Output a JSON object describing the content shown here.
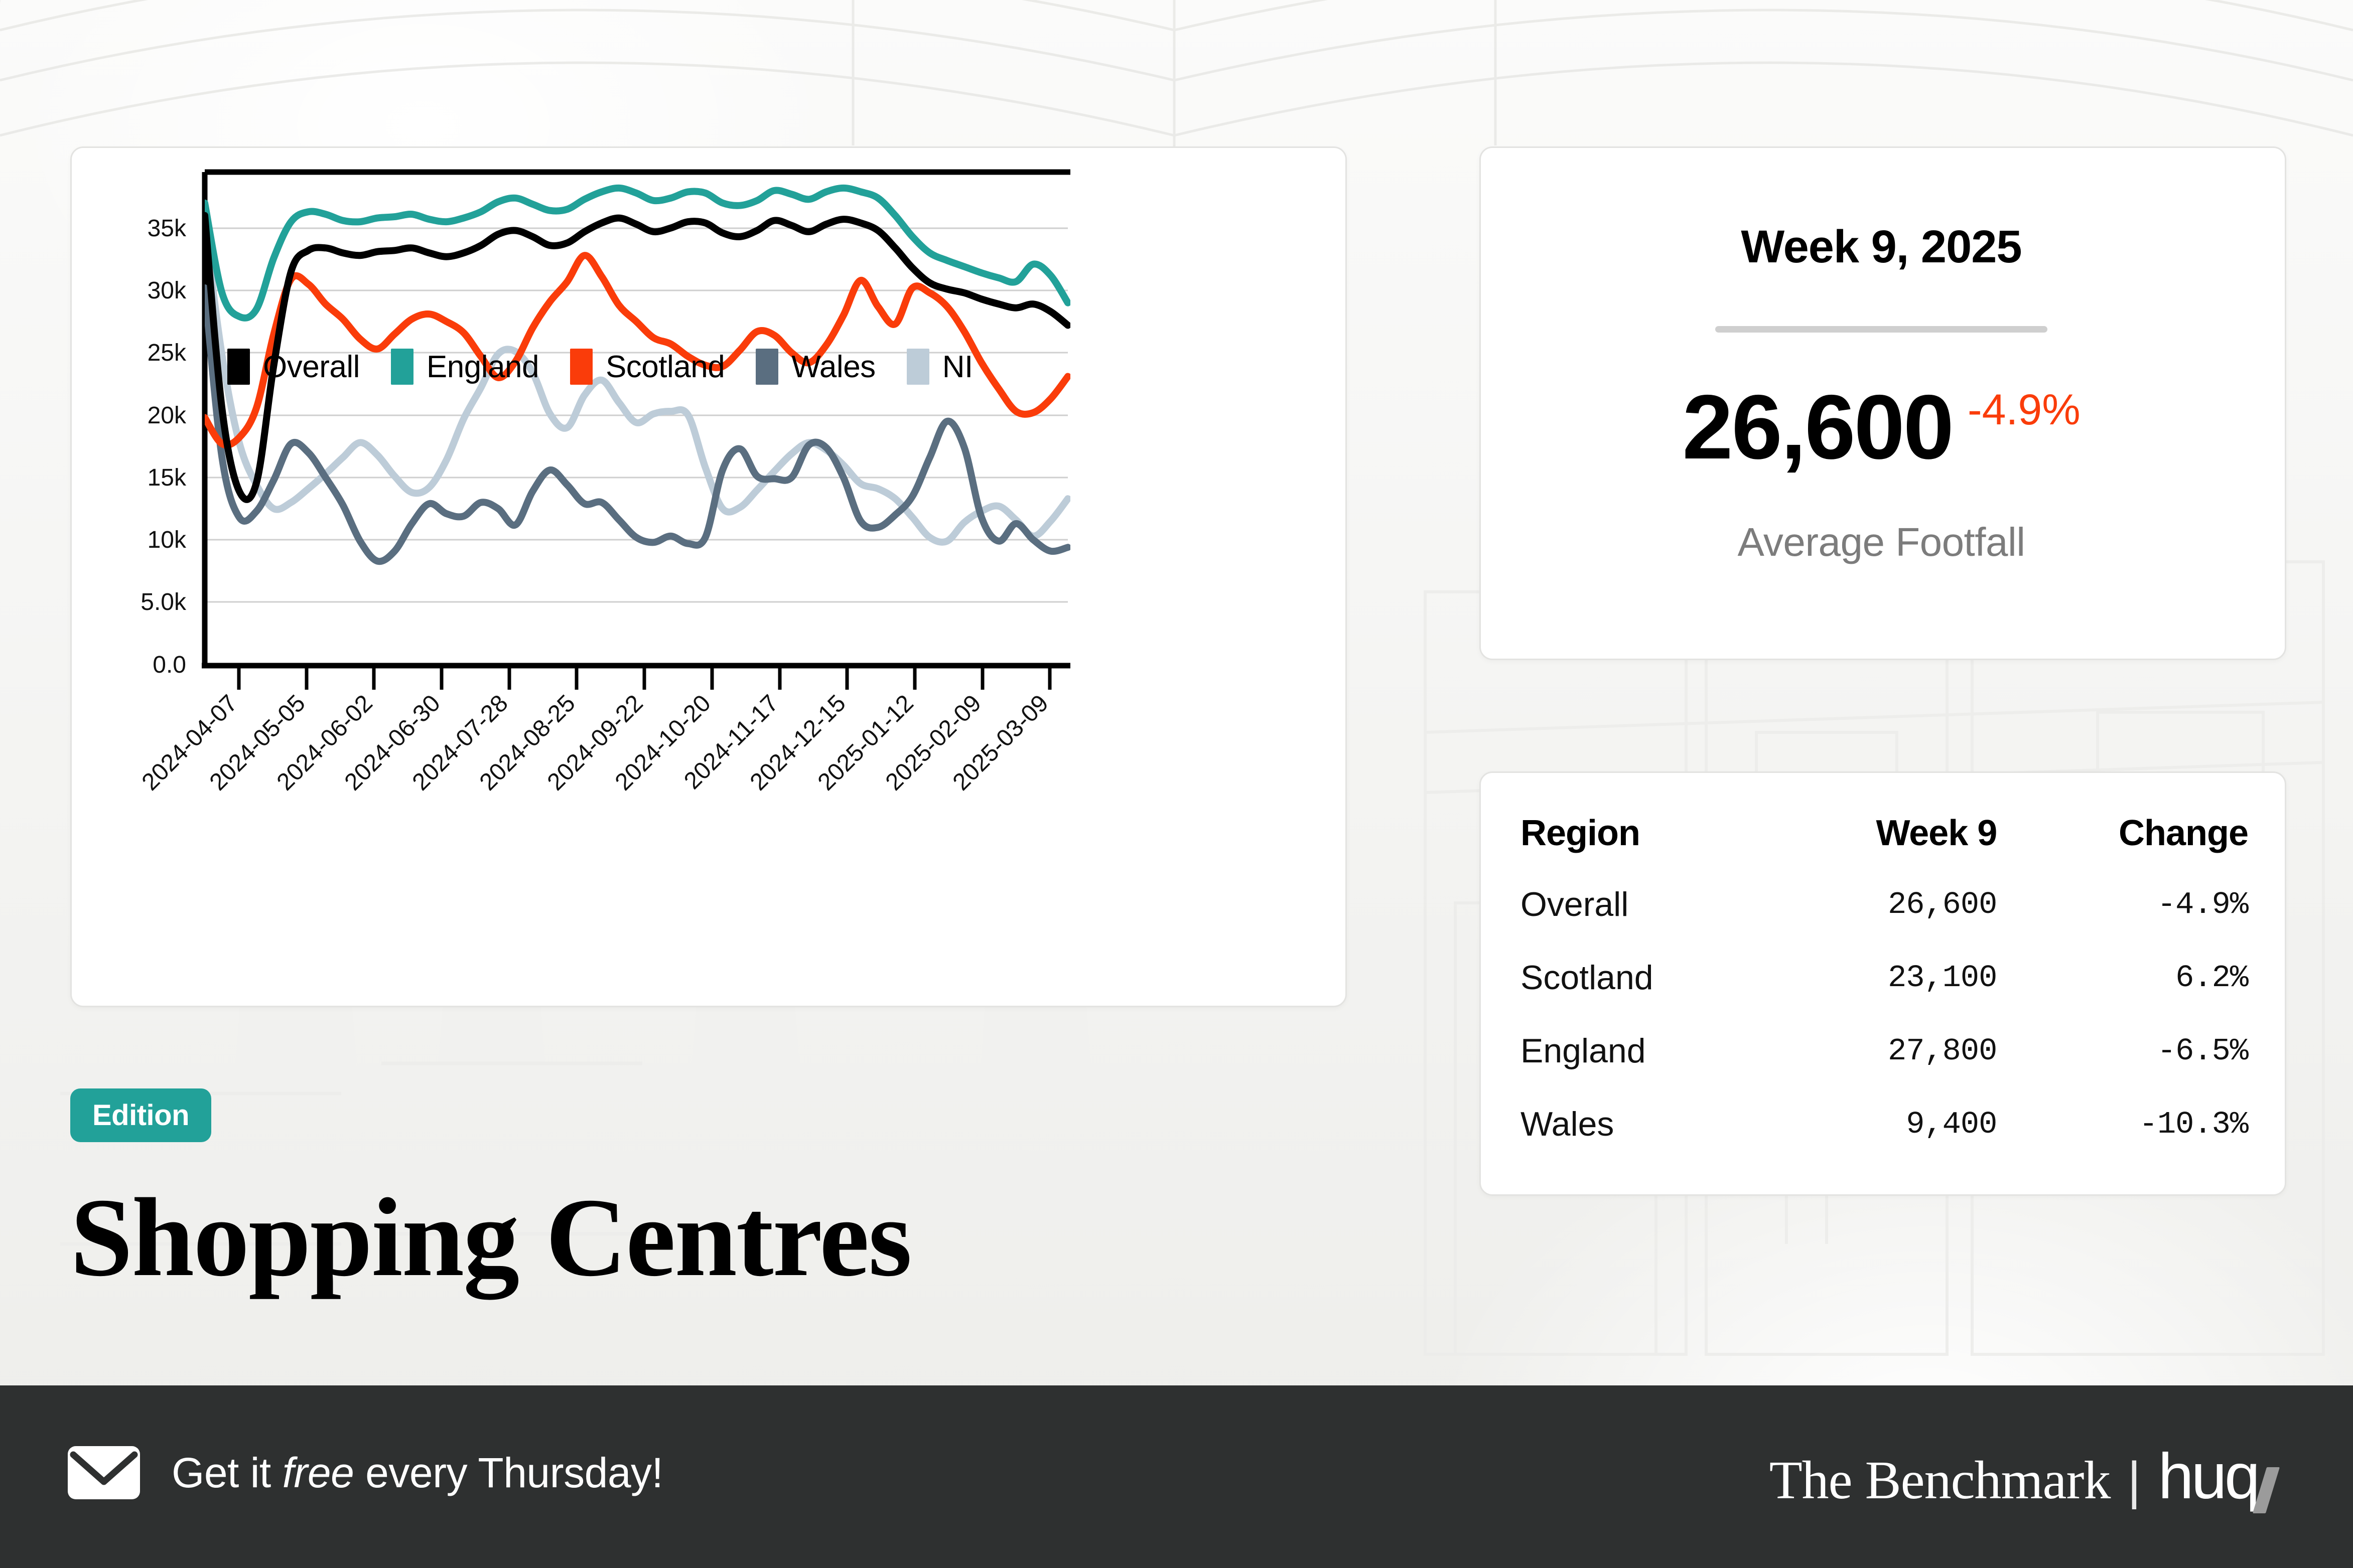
{
  "edition": {
    "badge": "Edition",
    "title": "Shopping Centres"
  },
  "kpi": {
    "title": "Week 9, 2025",
    "value": "26,600",
    "delta": "-4.9%",
    "delta_color": "#fa3c0a",
    "subtitle": "Average Footfall"
  },
  "table": {
    "columns": [
      "Region",
      "Week 9",
      "Change"
    ],
    "rows": [
      {
        "region": "Overall",
        "week9": "26,600",
        "change": "-4.9%"
      },
      {
        "region": "Scotland",
        "week9": "23,100",
        "change": "6.2%"
      },
      {
        "region": "England",
        "week9": "27,800",
        "change": "-6.5%"
      },
      {
        "region": "Wales",
        "week9": "9,400",
        "change": "-10.3%"
      }
    ]
  },
  "footer": {
    "cta_pre": "Get it ",
    "cta_em": "free",
    "cta_post": " every Thursday!",
    "brand_name": "The Benchmark",
    "brand_sep": "|",
    "brand_logo": "huq"
  },
  "chart_data": {
    "type": "line",
    "title": "",
    "xlabel": "",
    "ylabel": "",
    "ylim": [
      0,
      39000
    ],
    "grid": true,
    "legend_position": "top-left",
    "ytick_labels": [
      "0.0",
      "5.0k",
      "10k",
      "15k",
      "20k",
      "25k",
      "30k",
      "35k"
    ],
    "ytick_values": [
      0,
      5000,
      10000,
      15000,
      20000,
      25000,
      30000,
      35000
    ],
    "xtick_labels": [
      "2024-04-07",
      "2024-05-05",
      "2024-06-02",
      "2024-06-30",
      "2024-07-28",
      "2024-08-25",
      "2024-09-22",
      "2024-10-20",
      "2024-11-17",
      "2024-12-15",
      "2025-01-12",
      "2025-02-09",
      "2025-03-09"
    ],
    "xtick_positions": [
      2,
      6,
      10,
      14,
      18,
      22,
      26,
      30,
      34,
      38,
      42,
      46,
      50
    ],
    "x_index_count": 51,
    "series": [
      {
        "name": "Overall",
        "color": "#000000",
        "values": [
          36000,
          20500,
          13900,
          14600,
          24000,
          31500,
          33200,
          33400,
          33000,
          32800,
          33100,
          33200,
          33400,
          33000,
          32700,
          33000,
          33600,
          34500,
          34800,
          34300,
          33600,
          33800,
          34700,
          35400,
          35800,
          35300,
          34700,
          35000,
          35500,
          35400,
          34600,
          34300,
          34800,
          35600,
          35200,
          34700,
          35300,
          35700,
          35400,
          34800,
          33400,
          31800,
          30600,
          30100,
          29800,
          29300,
          28900,
          28600,
          28900,
          28300,
          27200
        ]
      },
      {
        "name": "England",
        "color": "#22a199",
        "values": [
          37000,
          29800,
          27900,
          28500,
          32600,
          35500,
          36300,
          36100,
          35600,
          35500,
          35800,
          35900,
          36100,
          35700,
          35500,
          35800,
          36300,
          37100,
          37400,
          36900,
          36400,
          36500,
          37300,
          37900,
          38200,
          37800,
          37200,
          37400,
          37900,
          37800,
          37000,
          36800,
          37200,
          38000,
          37700,
          37300,
          37900,
          38200,
          37900,
          37400,
          36000,
          34300,
          33000,
          32400,
          31900,
          31400,
          31000,
          30700,
          32100,
          31200,
          29000
        ]
      },
      {
        "name": "Scotland",
        "color": "#fa3c0a",
        "values": [
          19800,
          17700,
          18200,
          20600,
          26500,
          30900,
          30500,
          28900,
          27700,
          26100,
          25300,
          26500,
          27700,
          28100,
          27500,
          26600,
          24700,
          23000,
          24300,
          27000,
          29100,
          30700,
          32800,
          31100,
          28800,
          27500,
          26200,
          25700,
          24700,
          24000,
          23900,
          25200,
          26700,
          26400,
          25000,
          24200,
          25600,
          28000,
          30800,
          28700,
          27300,
          30200,
          29800,
          28700,
          26700,
          24200,
          22100,
          20300,
          20200,
          21300,
          23100
        ]
      },
      {
        "name": "Wales",
        "color": "#5a6e80",
        "values": [
          30200,
          16600,
          11800,
          12300,
          14800,
          17700,
          17000,
          15000,
          12800,
          9900,
          8300,
          9100,
          11300,
          12900,
          12100,
          11900,
          13000,
          12500,
          11200,
          13900,
          15600,
          14400,
          12900,
          13000,
          11600,
          10200,
          9800,
          10300,
          9700,
          10200,
          15600,
          17300,
          15100,
          14900,
          15000,
          17600,
          17400,
          15000,
          11500,
          11000,
          12000,
          13500,
          16600,
          19500,
          17400,
          11800,
          9900,
          11300,
          10000,
          9100,
          9400
        ]
      },
      {
        "name": "NI",
        "color": "#bdccd8",
        "values": [
          35300,
          24800,
          17800,
          14400,
          12500,
          13000,
          14100,
          15300,
          16600,
          17800,
          16800,
          15100,
          13800,
          14200,
          16400,
          19700,
          22200,
          24900,
          25100,
          23400,
          20100,
          19000,
          21600,
          22800,
          21000,
          19400,
          20100,
          20300,
          20000,
          15800,
          12500,
          12600,
          14000,
          15500,
          16900,
          17800,
          17200,
          16000,
          14500,
          14100,
          13300,
          11800,
          10200,
          9900,
          11400,
          12300,
          12700,
          11600,
          10300,
          11500,
          13300
        ]
      }
    ]
  }
}
